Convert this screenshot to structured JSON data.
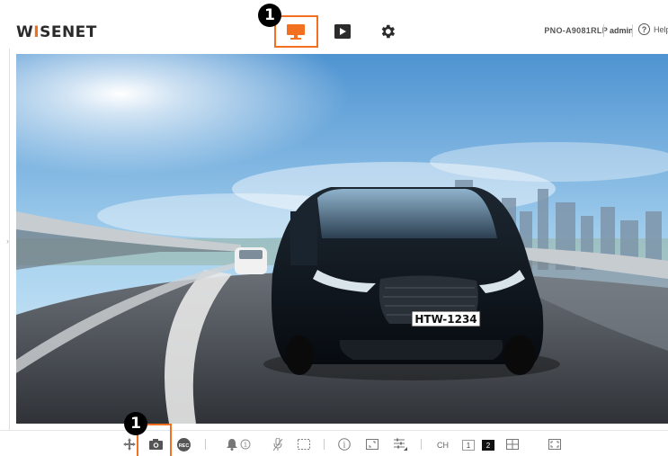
{
  "header": {
    "logo_pre": "W",
    "logo_hl": "I",
    "logo_post": "SENET",
    "device_name": "PNO-A9081RLP",
    "user": "admin",
    "help_label": "Help",
    "help_glyph": "?"
  },
  "nav": [
    {
      "icon": "monitor-icon"
    },
    {
      "icon": "play-icon"
    },
    {
      "icon": "gear-icon"
    }
  ],
  "callouts": {
    "top": "1",
    "bottom": "1"
  },
  "video": {
    "plate": "HTW-1234"
  },
  "toolbar": {
    "alarm_count": "1",
    "rec_label": "REC",
    "info_glyph": "i",
    "ch_label": "CH",
    "channels": [
      "1",
      "2"
    ],
    "active_channel": "2"
  },
  "colors": {
    "accent": "#f37021",
    "car": "#101820",
    "sky": "#79b2e0"
  }
}
